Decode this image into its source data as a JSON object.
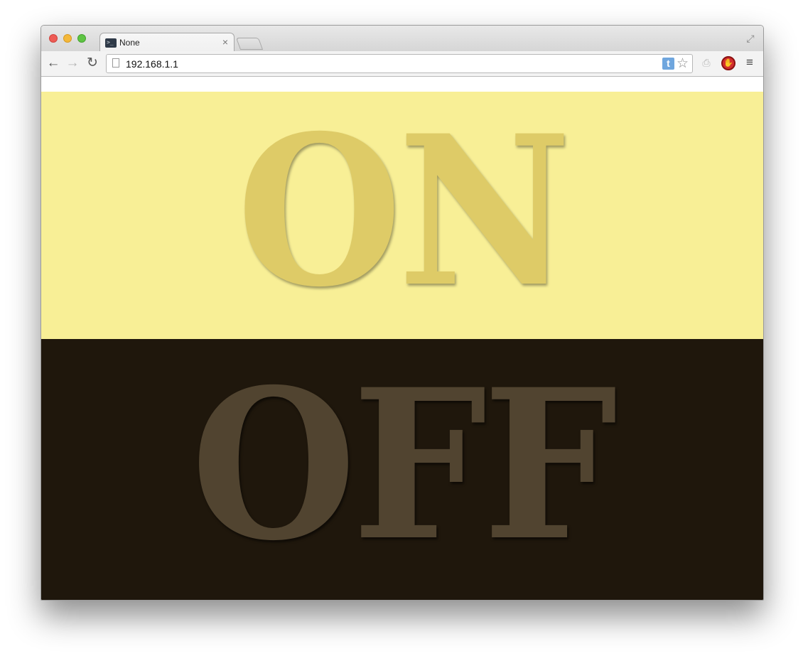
{
  "browser": {
    "tab": {
      "title": "None"
    },
    "address_bar": {
      "url": "192.168.1.1"
    },
    "extension_badge": "t"
  },
  "page": {
    "on_label": "ON",
    "off_label": "OFF",
    "colors": {
      "on_background": "#f8ef96",
      "on_text": "#decb67",
      "off_background": "#1f170c",
      "off_text": "#514430"
    }
  }
}
